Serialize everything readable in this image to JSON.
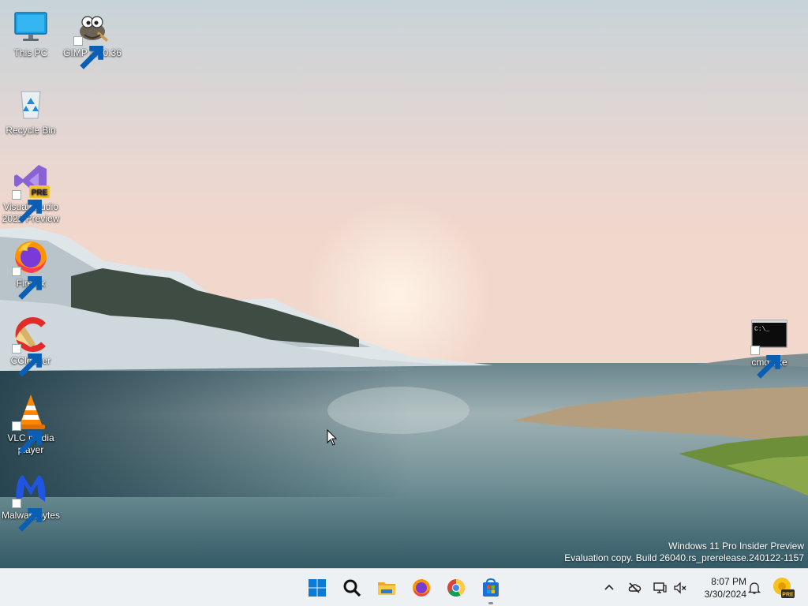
{
  "desktop": {
    "icons": [
      {
        "label": "This PC",
        "icon": "monitor-icon"
      },
      {
        "label": "GIMP 2.10.36",
        "icon": "gimp-icon"
      },
      {
        "label": "Recycle Bin",
        "icon": "recycle-bin-icon"
      },
      {
        "label": "Visual Studio 2022 Preview",
        "icon": "visual-studio-icon",
        "badge": "PRE"
      },
      {
        "label": "Firefox",
        "icon": "firefox-icon"
      },
      {
        "label": "CCleaner",
        "icon": "ccleaner-icon"
      },
      {
        "label": "VLC media player",
        "icon": "vlc-icon"
      },
      {
        "label": "Malwarebytes",
        "icon": "malwarebytes-icon"
      },
      {
        "label": "cmd.exe",
        "icon": "cmd-icon",
        "prompt": "C:\\_"
      }
    ],
    "watermark": {
      "line1": "Windows 11 Pro Insider Preview",
      "line2": "Evaluation copy. Build 26040.rs_prerelease.240122-1157"
    }
  },
  "taskbar": {
    "apps": [
      {
        "name": "Start",
        "icon": "windows-start-icon"
      },
      {
        "name": "Search",
        "icon": "search-icon"
      },
      {
        "name": "File Explorer",
        "icon": "folder-icon"
      },
      {
        "name": "Firefox",
        "icon": "firefox-icon"
      },
      {
        "name": "Chrome",
        "icon": "chrome-icon"
      },
      {
        "name": "Microsoft Store",
        "icon": "store-icon"
      }
    ],
    "tray": {
      "icons": [
        "chevron-up-icon",
        "cloud-off-icon",
        "network-icon",
        "volume-muted-icon"
      ],
      "time": "8:07 PM",
      "date": "3/30/2024",
      "notification_icon": "bell-icon",
      "preview_badge": "PRE"
    }
  },
  "colors": {
    "accent": "#0a7bd6",
    "taskbar": "#eef1f4"
  }
}
